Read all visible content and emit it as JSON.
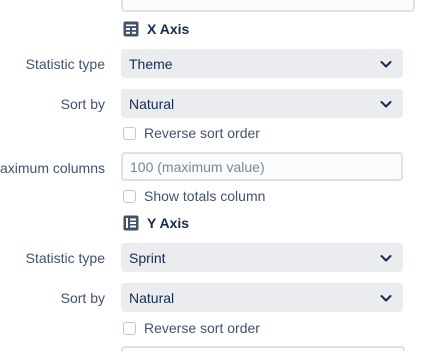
{
  "x_axis": {
    "title": "X Axis",
    "icon": "table-grid-icon",
    "statistic_type_label": "Statistic type",
    "statistic_type_value": "Theme",
    "sort_by_label": "Sort by",
    "sort_by_value": "Natural",
    "reverse_sort_label": "Reverse sort order",
    "max_columns_label": "aximum columns",
    "max_columns_placeholder": "100 (maximum value)",
    "show_totals_label": "Show totals column"
  },
  "y_axis": {
    "title": "Y Axis",
    "icon": "table-rows-icon",
    "statistic_type_label": "Statistic type",
    "statistic_type_value": "Sprint",
    "sort_by_label": "Sort by",
    "sort_by_value": "Natural",
    "reverse_sort_label": "Reverse sort order"
  },
  "colors": {
    "icon": "#42526e",
    "select_bg": "#ebecf0",
    "label": "#5e6c84"
  }
}
